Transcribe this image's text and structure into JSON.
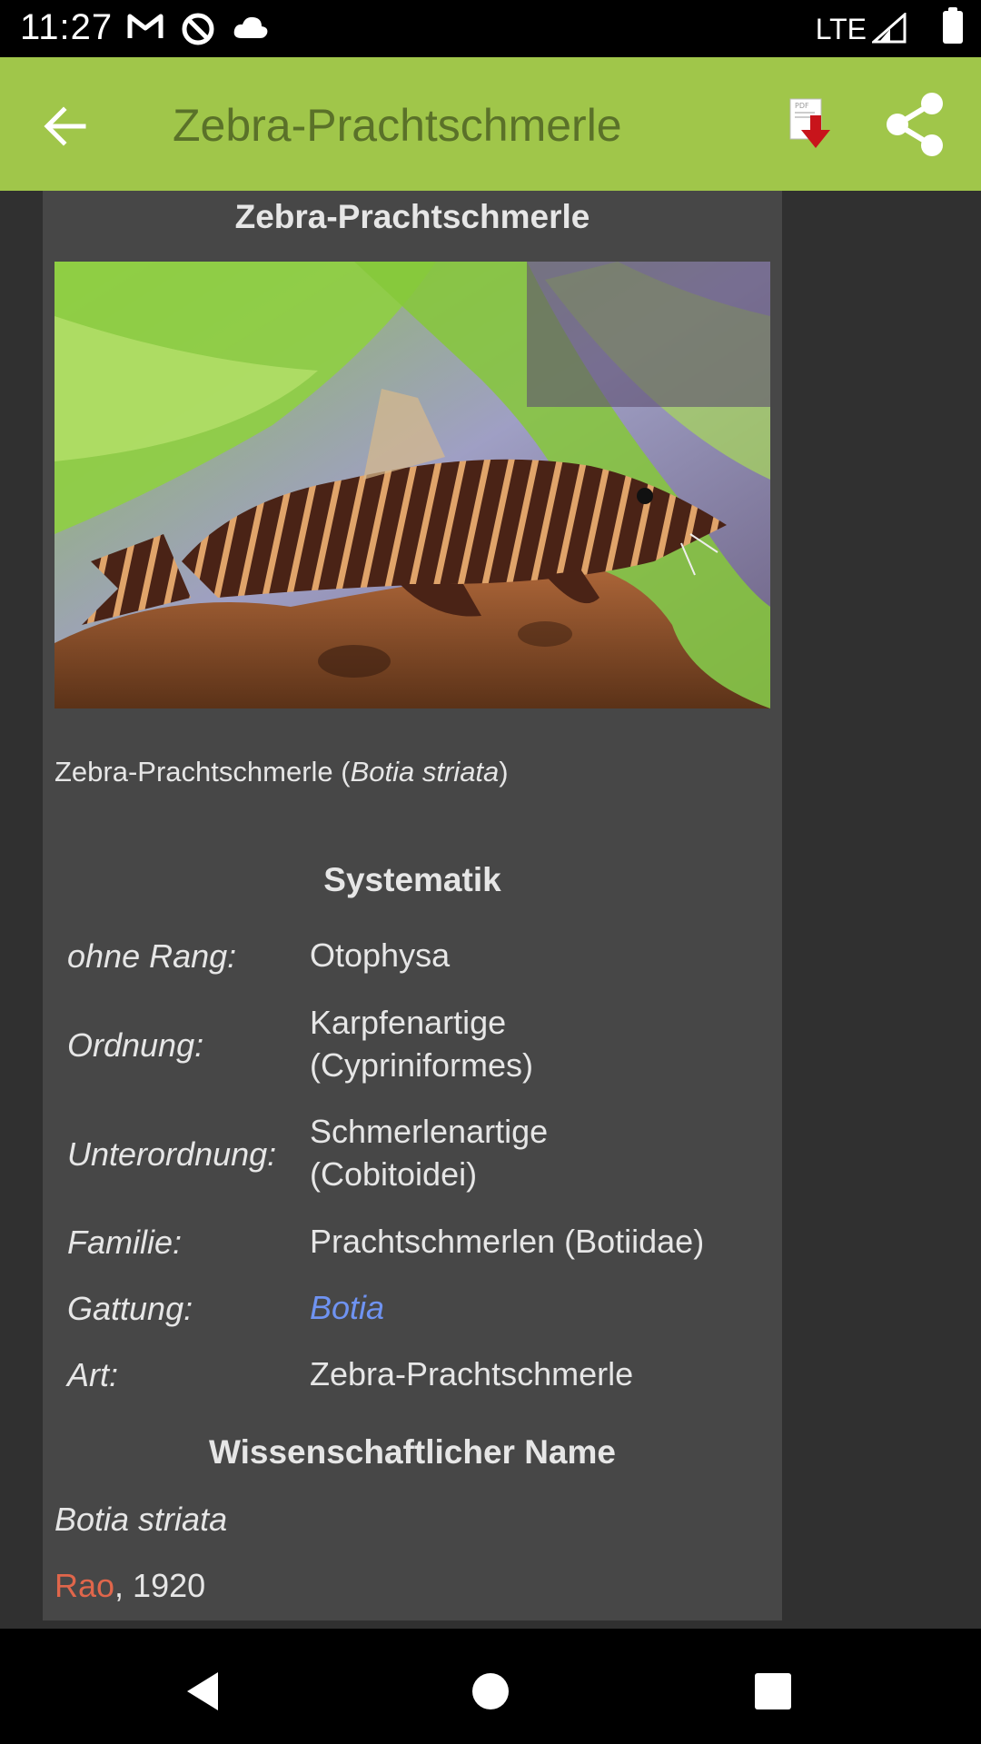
{
  "status_bar": {
    "time": "11:27",
    "network": "LTE",
    "icons": [
      "gmail-icon",
      "sync-icon",
      "cloud-icon",
      "signal-icon",
      "battery-icon"
    ]
  },
  "app_bar": {
    "title": "Zebra-Prachtschmerle",
    "back_icon": "arrow-back-icon",
    "pdf_icon": "pdf-download-icon",
    "share_icon": "share-icon",
    "background_color": "#a0c64a",
    "title_color": "#5a7129"
  },
  "article": {
    "title": "Zebra-Prachtschmerle",
    "image_alt": "Zebra-Prachtschmerle fish photo",
    "caption_prefix": "Zebra-Prachtschmerle (",
    "caption_italic": "Botia striata",
    "caption_suffix": ")",
    "systematik_heading": "Systematik",
    "taxonomy": [
      {
        "label": "ohne Rang:",
        "value": "Otophysa"
      },
      {
        "label": "Ordnung:",
        "value": "Karpfenartige (Cypriniformes)"
      },
      {
        "label": "Unterordnung:",
        "value": "Schmerlenartige (Cobitoidei)"
      },
      {
        "label": "Familie:",
        "value": "Prachtschmerlen (Botiidae)"
      },
      {
        "label": "Gattung:",
        "value": "Botia"
      },
      {
        "label": "Art:",
        "value": "Zebra-Prachtschmerle"
      }
    ],
    "scientific_heading": "Wissenschaftlicher Name",
    "scientific_name": "Botia striata",
    "author": "Rao",
    "author_year": ", 1920",
    "link_color": "#6f93f2",
    "author_link_color": "#e0664b"
  },
  "nav_bar": {
    "icons": [
      "nav-back-icon",
      "nav-home-icon",
      "nav-recents-icon"
    ]
  }
}
